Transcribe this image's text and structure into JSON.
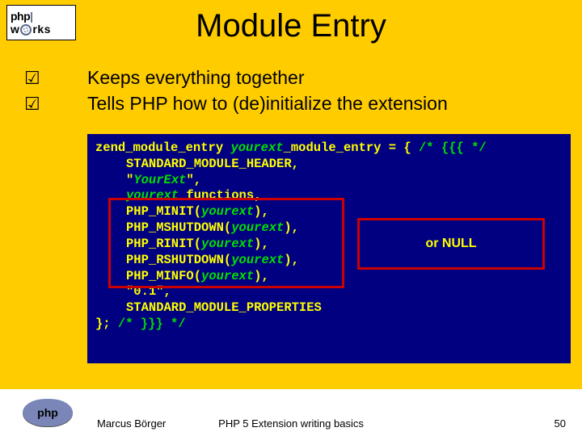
{
  "logo": {
    "line1_a": "php",
    "line1_b": "|",
    "line2_a": "w",
    "line2_b": "rks"
  },
  "title": "Module Entry",
  "bullets": [
    "Keeps everything together",
    "Tells PHP how to (de)initialize the extension"
  ],
  "code": {
    "l0_a": "zend_module_entry ",
    "l0_b": "yourext",
    "l0_c": "_module_entry = { ",
    "l0_d": "/* {{{ */",
    "l1": "STANDARD_MODULE_HEADER,",
    "l2_a": "\"",
    "l2_b": "YourExt",
    "l2_c": "\",",
    "l3_a": "yourext",
    "l3_b": "_functions,",
    "l4_a": "PHP_MINIT(",
    "l4_b": "yourext",
    "l4_c": "),",
    "l5_a": "PHP_MSHUTDOWN(",
    "l5_b": "yourext",
    "l5_c": "),",
    "l6_a": "PHP_RINIT(",
    "l6_b": "yourext",
    "l6_c": "),",
    "l7_a": "PHP_RSHUTDOWN(",
    "l7_b": "yourext",
    "l7_c": "),",
    "l8_a": "PHP_MINFO(",
    "l8_b": "yourext",
    "l8_c": "),",
    "l9": "\"0.1\",",
    "l10": "STANDARD_MODULE_PROPERTIES",
    "l11_a": "}; ",
    "l11_b": "/* }}} */"
  },
  "callout": "or NULL",
  "footer": {
    "badge": "php",
    "author": "Marcus Börger",
    "mid": "PHP 5 Extension writing basics",
    "page": "50"
  }
}
